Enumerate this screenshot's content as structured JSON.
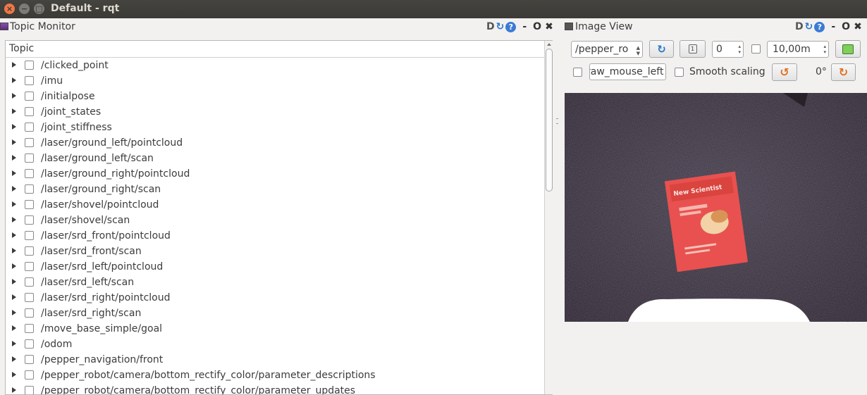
{
  "window": {
    "title": "Default - rqt"
  },
  "topic_monitor": {
    "title": "Topic Monitor",
    "header_buttons": {
      "d": "D",
      "min": "-",
      "float": "O",
      "close": "✖"
    },
    "column_header": "Topic",
    "topics": [
      "/clicked_point",
      "/imu",
      "/initialpose",
      "/joint_states",
      "/joint_stiffness",
      "/laser/ground_left/pointcloud",
      "/laser/ground_left/scan",
      "/laser/ground_right/pointcloud",
      "/laser/ground_right/scan",
      "/laser/shovel/pointcloud",
      "/laser/shovel/scan",
      "/laser/srd_front/pointcloud",
      "/laser/srd_front/scan",
      "/laser/srd_left/pointcloud",
      "/laser/srd_left/scan",
      "/laser/srd_right/pointcloud",
      "/laser/srd_right/scan",
      "/move_base_simple/goal",
      "/odom",
      "/pepper_navigation/front",
      "/pepper_robot/camera/bottom_rectify_color/parameter_descriptions",
      "/pepper_robot/camera/bottom_rectify_color/parameter_updates"
    ]
  },
  "image_view": {
    "title": "Image View",
    "header_buttons": {
      "d": "D",
      "min": "-",
      "float": "O",
      "close": "✖"
    },
    "topic_select": "/pepper_ro",
    "value_spin": "0",
    "max_range": "10,00m",
    "mouse_topic": "raw_mouse_left",
    "smooth_scaling_label": "Smooth scaling",
    "rotation_label": "0°",
    "magazine": {
      "title": "New Scientist"
    }
  }
}
